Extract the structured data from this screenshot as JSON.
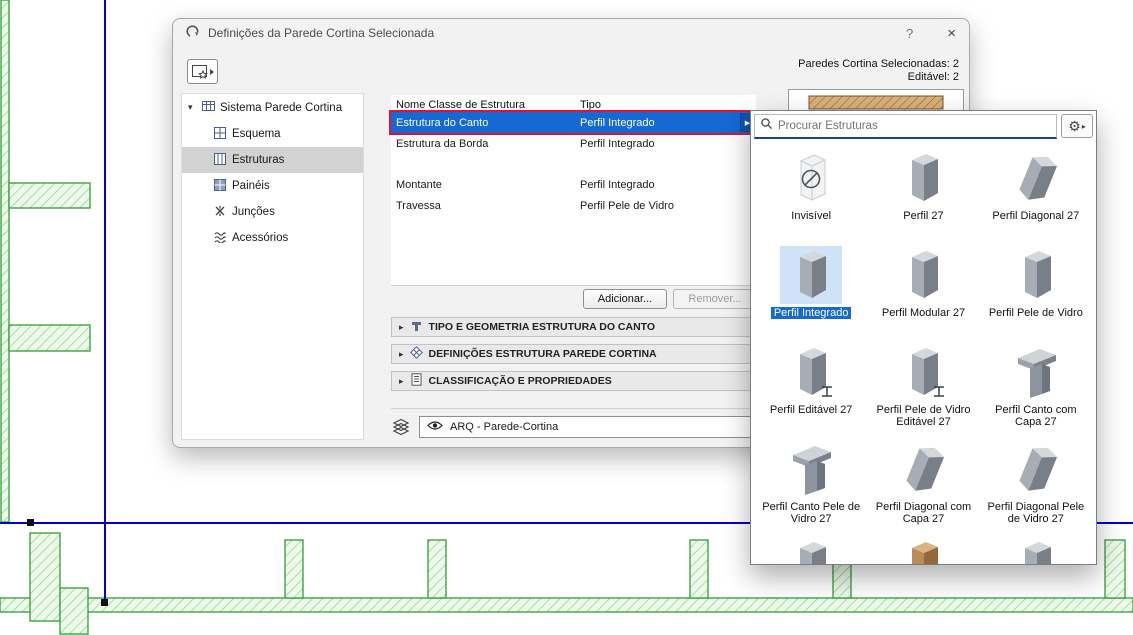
{
  "colors": {
    "selection_blue": "#1569d3",
    "highlight_red": "#e8112d",
    "cad_green": "#2f9e33",
    "cad_green_light": "#7ecb78",
    "cad_blue": "#0000cd",
    "search_underline": "#23408f"
  },
  "icons": {
    "chevron_down": "▾",
    "section_arrow": "▸",
    "row_arrow": "▶",
    "gear": "⚙",
    "gear_arrow": "▸"
  },
  "dialog": {
    "title": "Definições da Parede Cortina Selecionada",
    "help": "?",
    "close": "×",
    "selected_count_label": "Paredes Cortina Selecionadas: 2",
    "editable_count_label": "Editável: 2",
    "tree": {
      "root": "Sistema Parede Cortina",
      "items": [
        {
          "id": "esquema",
          "label": "Esquema",
          "icon": "scheme-icon",
          "selected": false
        },
        {
          "id": "estruturas",
          "label": "Estruturas",
          "icon": "frames-icon",
          "selected": true
        },
        {
          "id": "paineis",
          "label": "Painéis",
          "icon": "panels-icon",
          "selected": false
        },
        {
          "id": "juncoes",
          "label": "Junções",
          "icon": "junctions-icon",
          "selected": false
        },
        {
          "id": "acessorios",
          "label": "Acessórios",
          "icon": "accessories-icon",
          "selected": false
        }
      ]
    },
    "table": {
      "col_name": "Nome Classe de Estrutura",
      "col_type": "Tipo",
      "rows": [
        {
          "name": "Estrutura do Canto",
          "type": "Perfil Integrado",
          "selected": true
        },
        {
          "name": "Estrutura da Borda",
          "type": "Perfil Integrado",
          "selected": false
        },
        {
          "name": "Montante",
          "type": "Perfil Integrado",
          "selected": false
        },
        {
          "name": "Travessa",
          "type": "Perfil Pele de Vidro",
          "selected": false
        }
      ]
    },
    "add_button": "Adicionar...",
    "remove_button": "Remover...",
    "sections": [
      {
        "label": "TIPO E GEOMETRIA ESTRUTURA DO CANTO",
        "icon": "geometry-icon"
      },
      {
        "label": "DEFINIÇÕES ESTRUTURA PAREDE CORTINA",
        "icon": "definitions-icon"
      },
      {
        "label": "CLASSIFICAÇÃO E PROPRIEDADES",
        "icon": "classification-icon"
      }
    ],
    "layer": {
      "name": "ARQ - Parede-Cortina"
    }
  },
  "popup": {
    "search_placeholder": "Procurar Estruturas",
    "items": [
      {
        "label": "Invisível",
        "variant": "ghost",
        "selected": false
      },
      {
        "label": "Perfil 27",
        "variant": "prism",
        "selected": false
      },
      {
        "label": "Perfil Diagonal 27",
        "variant": "diagonal",
        "selected": false
      },
      {
        "label": "Perfil Integrado",
        "variant": "prism",
        "selected": true
      },
      {
        "label": "Perfil Modular 27",
        "variant": "prism",
        "selected": false
      },
      {
        "label": "Perfil Pele de Vidro",
        "variant": "prism",
        "selected": false
      },
      {
        "label": "Perfil Editável 27",
        "variant": "editable",
        "selected": false
      },
      {
        "label": "Perfil Pele de Vidro Editável 27",
        "variant": "editable",
        "selected": false
      },
      {
        "label": "Perfil Canto com Capa 27",
        "variant": "corner",
        "selected": false
      },
      {
        "label": "Perfil Canto Pele de Vidro 27",
        "variant": "corner",
        "selected": false
      },
      {
        "label": "Perfil Diagonal com Capa 27",
        "variant": "diagonal",
        "selected": false
      },
      {
        "label": "Perfil Diagonal Pele de Vidro 27",
        "variant": "diagonal",
        "selected": false
      },
      {
        "label": "",
        "variant": "prism",
        "partial": true
      },
      {
        "label": "",
        "variant": "wood",
        "partial": true
      },
      {
        "label": "",
        "variant": "prism",
        "partial": true
      }
    ]
  }
}
